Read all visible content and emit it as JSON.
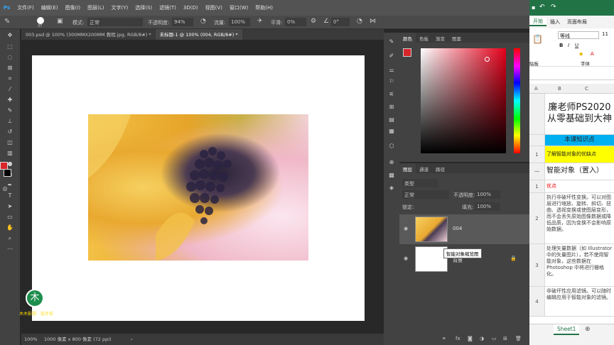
{
  "menubar": [
    "文件(F)",
    "编辑(E)",
    "图像(I)",
    "图层(L)",
    "文字(Y)",
    "选择(S)",
    "滤镜(T)",
    "3D(D)",
    "视图(V)",
    "窗口(W)",
    "帮助(H)"
  ],
  "options": {
    "brush_size": "37",
    "mode_label": "模式:",
    "mode_value": "正常",
    "opacity_label": "不透明度:",
    "opacity_value": "94%",
    "flow_label": "流量:",
    "flow_value": "100%",
    "smooth_label": "平滑:",
    "smooth_value": "0%",
    "angle_value": "0°"
  },
  "tabs": [
    "003.psd @ 100% (300MMX200MM 教程.jpg, RGB/8#) *",
    "未标题-1 @ 100% (004, RGB/8#) *"
  ],
  "status": {
    "zoom": "100%",
    "doc_info": "1000 像素 x 800 像素 (72 ppi)"
  },
  "color_panel": {
    "tabs": [
      "颜色",
      "色板",
      "渐变",
      "图案"
    ],
    "fg": "#d8262b",
    "bg": "#000000"
  },
  "layers_panel": {
    "tabs": [
      "图层",
      "通道",
      "路径"
    ],
    "filter_label": "类型",
    "blend_mode": "正常",
    "opacity_label": "不透明度:",
    "opacity_value": "100%",
    "lock_label": "锁定:",
    "fill_label": "填充:",
    "fill_value": "100%",
    "layers": [
      {
        "name": "004"
      },
      {
        "name": "背景"
      }
    ],
    "tooltip": "智能对象缩览图"
  },
  "logo": {
    "glyph": "木",
    "caption": "木木影视 · 设计坊"
  },
  "excel": {
    "ribbon_tabs": [
      "开始",
      "插入",
      "页面布局"
    ],
    "font_name": "等线",
    "font_size": "11",
    "clipboard_label": "贴板",
    "font_group_label": "字体",
    "col_headers": [
      "A",
      "B",
      "C"
    ],
    "rows": [
      {
        "num": "",
        "text": "廉老师PS2020从零基础到大神",
        "style": "title"
      },
      {
        "num": "",
        "text": "本课知识点",
        "style": "cyan"
      },
      {
        "num": "1",
        "text": "了解智能对象的优缺点",
        "style": "yellow"
      },
      {
        "num": "一",
        "text": "智能对象（置入）",
        "style": "big"
      },
      {
        "num": "1",
        "text": "优点",
        "style": "red"
      },
      {
        "num": "2",
        "text": "执行非破坏性变换。可以对图层进行缩放、旋转、斜切、扭曲、透视变换或使图层变形，而不会丢失原始图像数据或降低品质，因为变换不会影响原始数据。",
        "style": "plain"
      },
      {
        "num": "3",
        "text": "处理矢量数据（如 Illustrator 中的矢量图片），若不使用智能对象，这些数据在 Photoshop 中将进行栅格化。",
        "style": "plain"
      },
      {
        "num": "4",
        "text": "非破坏性应用滤镜。可以随时编辑应用于智能对象的滤镜。",
        "style": "plain"
      }
    ],
    "sheet_tab": "Sheet1"
  }
}
